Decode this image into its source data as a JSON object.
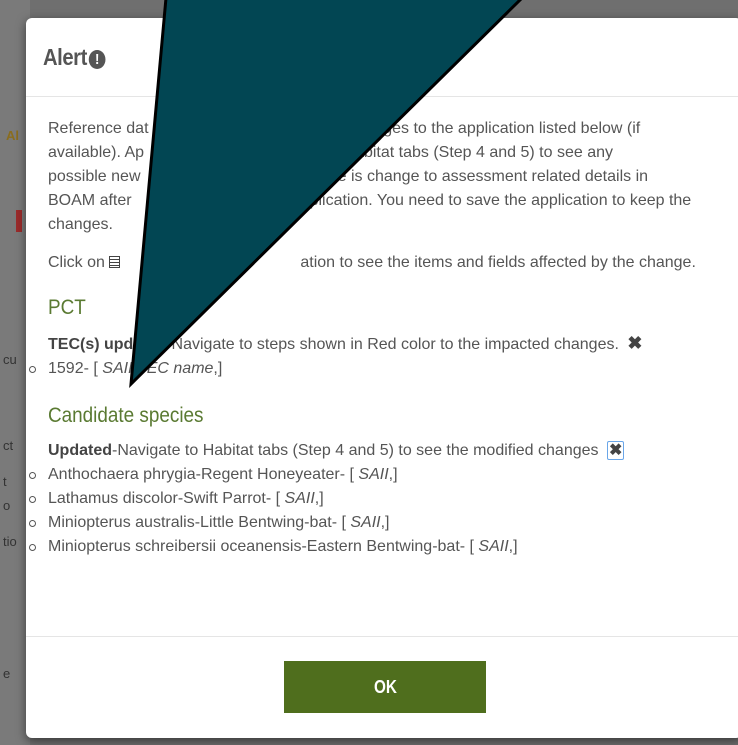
{
  "background": {
    "fragments": [
      "cu",
      "ct",
      "t",
      "o",
      "tio",
      "e"
    ]
  },
  "dialog": {
    "title": "Alert",
    "intro_text": "Reference data has been updated. There are changes to the application listed below (if available). Approved list Step 3, and visit Habitat tabs (Step 4 and 5) to see any possible new species listed. You will see there is change to assessment related details in BOAM after loading the application. You need to save the application to keep the changes.",
    "intro_visible": {
      "line1a": "Reference dat",
      "line1b": "hanges to the application listed below (if",
      "line2a": "available). Ap",
      "line2b": "sit Habitat tabs (Step 4 and 5) to see any",
      "line3a": "possible new",
      "line3b": "here is change to assessment related details in",
      "line4a": "BOAM after",
      "line4b": "plication. You need to save the application to keep the",
      "line5": "changes."
    },
    "click_text_a": "Click on",
    "click_text_b": "ation to see the items and fields affected by the change.",
    "sections": {
      "pct": {
        "heading": "PCT",
        "notice_bold": "TEC(s) updated",
        "notice_rest": "-Navigate to steps shown in Red color to the impacted changes.",
        "items": [
          {
            "prefix": "1592- [ ",
            "tags": "SAII,TEC name",
            "suffix": ",]"
          }
        ]
      },
      "species": {
        "heading": "Candidate species",
        "notice_bold": "Updated",
        "notice_rest": "-Navigate to Habitat tabs (Step 4 and 5) to see the modified changes",
        "items": [
          {
            "prefix": "Anthochaera phrygia-Regent Honeyeater- [ ",
            "tags": "SAII",
            "suffix": ",]"
          },
          {
            "prefix": "Lathamus discolor-Swift Parrot- [ ",
            "tags": "SAII",
            "suffix": ",]"
          },
          {
            "prefix": "Miniopterus australis-Little Bentwing-bat- [ ",
            "tags": "SAII",
            "suffix": ",]"
          },
          {
            "prefix": "Miniopterus schreibersii oceanensis-Eastern Bentwing-bat- [ ",
            "tags": "SAII",
            "suffix": ",]"
          }
        ]
      }
    },
    "ok_label": "OK"
  },
  "colors": {
    "accent_green": "#4f6e1d",
    "heading_green": "#5a7a32",
    "pointer_fill": "#024653",
    "overlay": "#6f6f6f"
  },
  "icons": [
    "alert-icon",
    "list-icon",
    "close-icon"
  ]
}
